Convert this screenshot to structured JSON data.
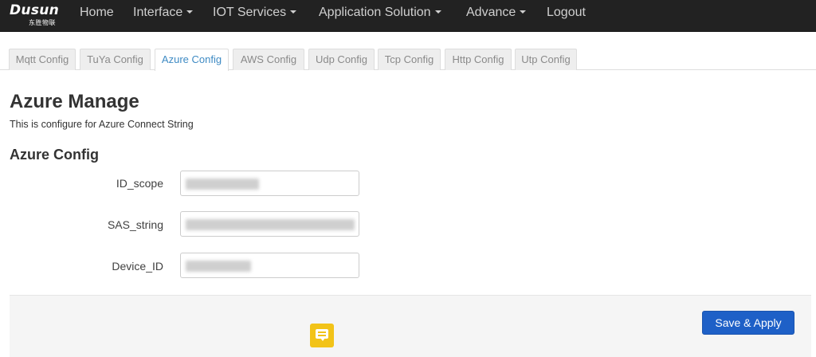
{
  "brand": {
    "name": "Dusun",
    "subtitle": "东胜物联"
  },
  "nav": {
    "items": [
      {
        "label": "Home",
        "dropdown": false
      },
      {
        "label": "Interface",
        "dropdown": true
      },
      {
        "label": "IOT Services",
        "dropdown": true
      },
      {
        "label": "Application Solution",
        "dropdown": true
      },
      {
        "label": "Advance",
        "dropdown": true
      },
      {
        "label": "Logout",
        "dropdown": false
      }
    ]
  },
  "tabs": {
    "items": [
      "Mqtt Config",
      "TuYa Config",
      "Azure Config",
      "AWS Config",
      "Udp Config",
      "Tcp Config",
      "Http Config",
      "Utp Config"
    ],
    "active": "Azure Config"
  },
  "page": {
    "title": "Azure Manage",
    "description": "This is configure for Azure Connect String",
    "section_title": "Azure Config"
  },
  "form": {
    "fields": [
      {
        "label": "ID_scope",
        "value": ""
      },
      {
        "label": "SAS_string",
        "value": ""
      },
      {
        "label": "Device_ID",
        "value": ""
      }
    ]
  },
  "actions": {
    "save_label": "Save & Apply"
  },
  "colors": {
    "navbar": "#222222",
    "active_tab_text": "#3f8bc4",
    "primary_button": "#1e60c7",
    "chat_widget": "#f2c318"
  },
  "icons": {
    "chat": "chat-bubble-icon"
  }
}
